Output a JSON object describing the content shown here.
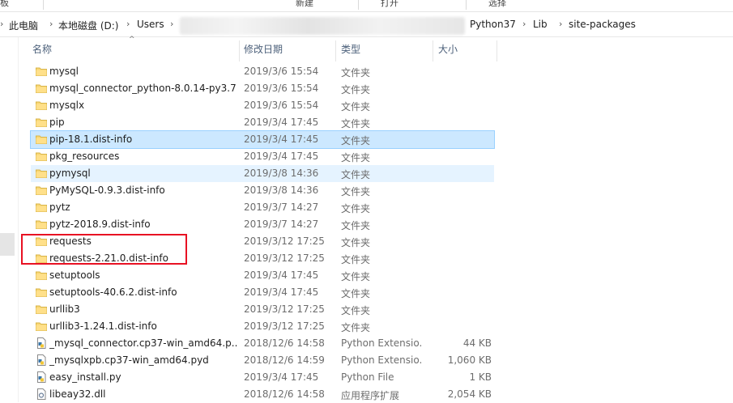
{
  "ribbon": {
    "items": [
      "板",
      "新建",
      "打开",
      "选择"
    ]
  },
  "address": {
    "crumbs": [
      "此电脑",
      "本地磁盘 (D:)",
      "Users",
      "Python37",
      "Lib",
      "site-packages"
    ]
  },
  "columns": {
    "name": "名称",
    "date": "修改日期",
    "type": "类型",
    "size": "大小"
  },
  "files": [
    {
      "name": "mysql",
      "date": "2019/3/6 15:54",
      "type": "文件夹",
      "size": "",
      "icon": "folder-icon"
    },
    {
      "name": "mysql_connector_python-8.0.14-py3.7...",
      "date": "2019/3/6 15:54",
      "type": "文件夹",
      "size": "",
      "icon": "folder-icon"
    },
    {
      "name": "mysqlx",
      "date": "2019/3/6 15:54",
      "type": "文件夹",
      "size": "",
      "icon": "folder-icon"
    },
    {
      "name": "pip",
      "date": "2019/3/4 17:45",
      "type": "文件夹",
      "size": "",
      "icon": "folder-icon"
    },
    {
      "name": "pip-18.1.dist-info",
      "date": "2019/3/4 17:45",
      "type": "文件夹",
      "size": "",
      "icon": "folder-icon",
      "state": "selected"
    },
    {
      "name": "pkg_resources",
      "date": "2019/3/4 17:45",
      "type": "文件夹",
      "size": "",
      "icon": "folder-icon"
    },
    {
      "name": "pymysql",
      "date": "2019/3/8 14:36",
      "type": "文件夹",
      "size": "",
      "icon": "folder-icon",
      "state": "hover"
    },
    {
      "name": "PyMySQL-0.9.3.dist-info",
      "date": "2019/3/8 14:36",
      "type": "文件夹",
      "size": "",
      "icon": "folder-icon"
    },
    {
      "name": "pytz",
      "date": "2019/3/7 14:27",
      "type": "文件夹",
      "size": "",
      "icon": "folder-icon"
    },
    {
      "name": "pytz-2018.9.dist-info",
      "date": "2019/3/7 14:27",
      "type": "文件夹",
      "size": "",
      "icon": "folder-icon"
    },
    {
      "name": "requests",
      "date": "2019/3/12 17:25",
      "type": "文件夹",
      "size": "",
      "icon": "folder-icon"
    },
    {
      "name": "requests-2.21.0.dist-info",
      "date": "2019/3/12 17:25",
      "type": "文件夹",
      "size": "",
      "icon": "folder-icon"
    },
    {
      "name": "setuptools",
      "date": "2019/3/4 17:45",
      "type": "文件夹",
      "size": "",
      "icon": "folder-icon"
    },
    {
      "name": "setuptools-40.6.2.dist-info",
      "date": "2019/3/4 17:45",
      "type": "文件夹",
      "size": "",
      "icon": "folder-icon"
    },
    {
      "name": "urllib3",
      "date": "2019/3/12 17:25",
      "type": "文件夹",
      "size": "",
      "icon": "folder-icon"
    },
    {
      "name": "urllib3-1.24.1.dist-info",
      "date": "2019/3/12 17:25",
      "type": "文件夹",
      "size": "",
      "icon": "folder-icon"
    },
    {
      "name": "_mysql_connector.cp37-win_amd64.p...",
      "date": "2018/12/6 14:58",
      "type": "Python Extensio...",
      "size": "44 KB",
      "icon": "python-file-icon"
    },
    {
      "name": "_mysqlxpb.cp37-win_amd64.pyd",
      "date": "2018/12/6 14:59",
      "type": "Python Extensio...",
      "size": "1,060 KB",
      "icon": "python-file-icon"
    },
    {
      "name": "easy_install.py",
      "date": "2019/3/4 17:45",
      "type": "Python File",
      "size": "1 KB",
      "icon": "python-file-icon"
    },
    {
      "name": "libeay32.dll",
      "date": "2018/12/6 14:58",
      "type": "应用程序扩展",
      "size": "2,054 KB",
      "icon": "dll-file-icon"
    }
  ],
  "colors": {
    "selected": "#cce8ff",
    "hover": "#e5f3ff",
    "highlight_box": "#e81123",
    "folder": "#f8d775"
  }
}
